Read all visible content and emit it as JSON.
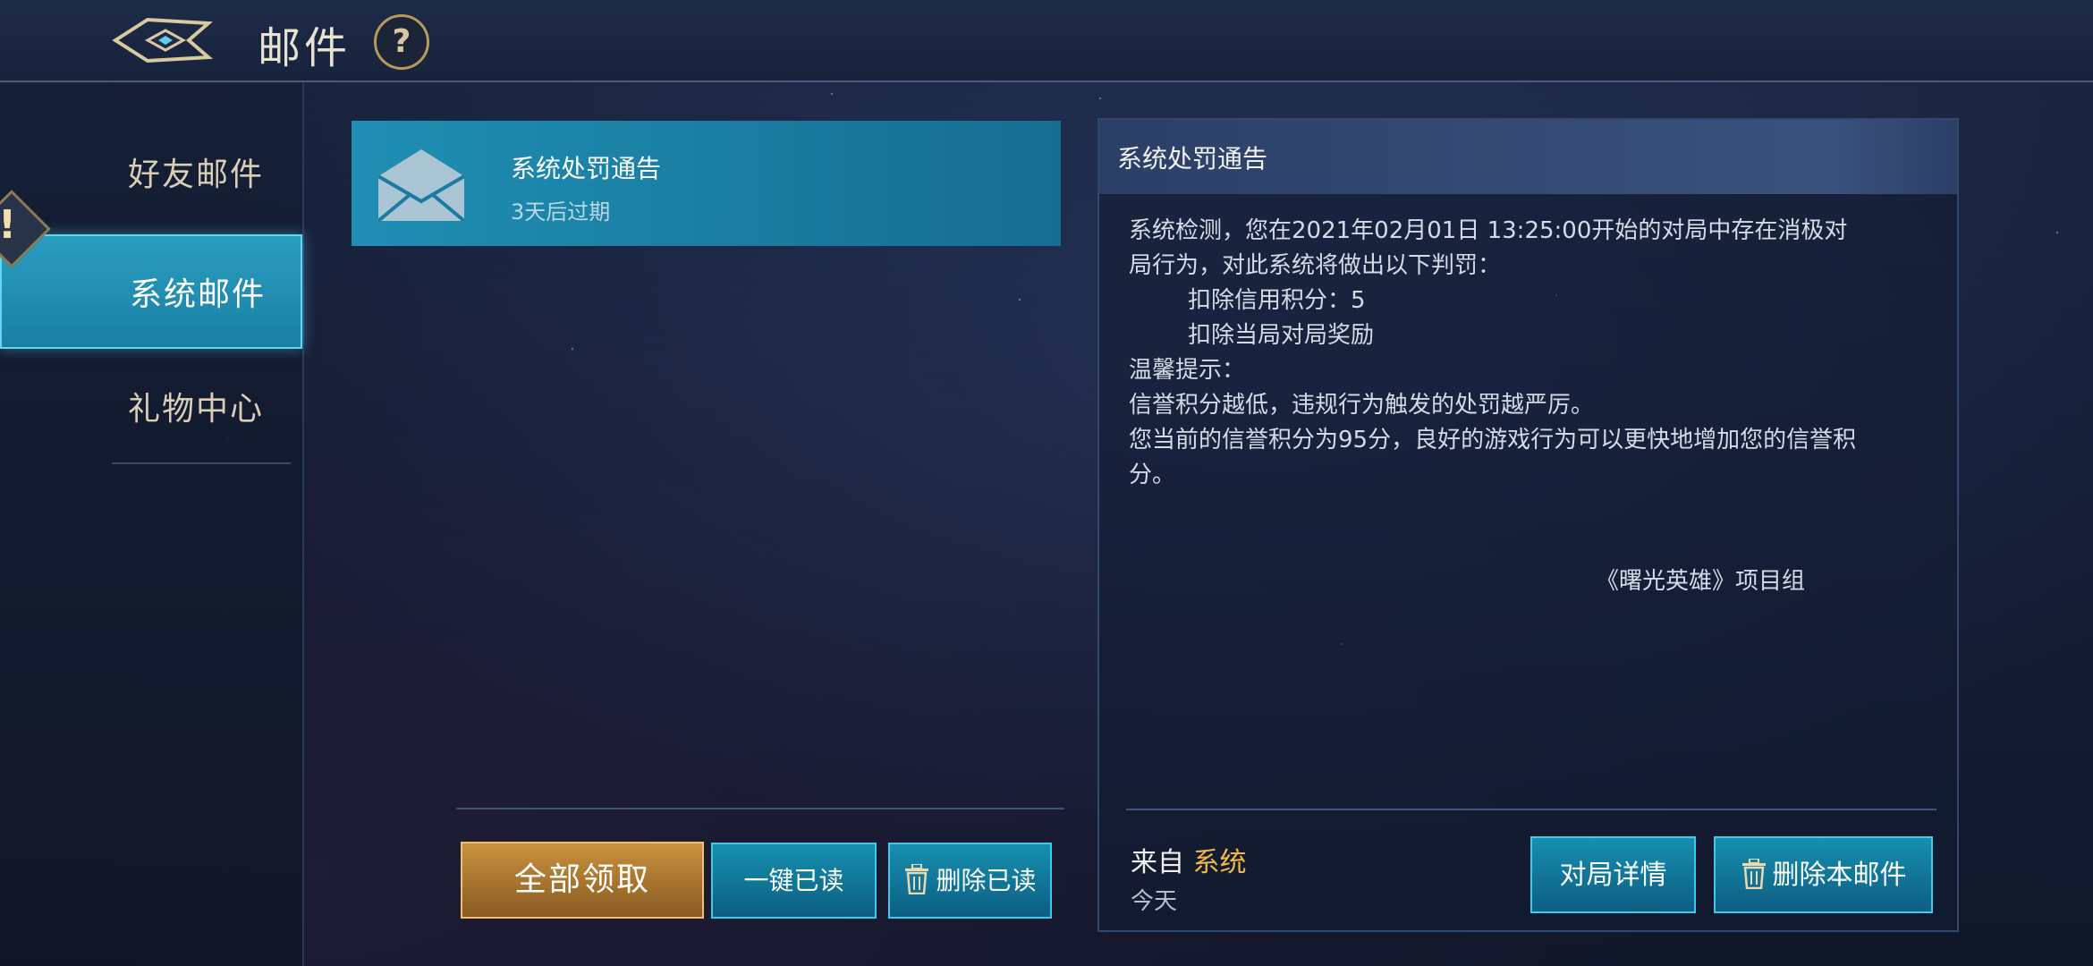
{
  "header": {
    "title": "邮件",
    "help_label": "?"
  },
  "sidebar": {
    "items": [
      {
        "label": "好友邮件"
      },
      {
        "label": "系统邮件"
      },
      {
        "label": "礼物中心"
      }
    ],
    "alert_label": "!"
  },
  "mail_list": [
    {
      "title": "系统处罚通告",
      "expire": "3天后过期"
    }
  ],
  "list_actions": {
    "claim_all": "全部领取",
    "read_all": "一键已读",
    "delete_read": "删除已读"
  },
  "detail": {
    "title": "系统处罚通告",
    "lines": [
      "系统检测，您在2021年02月01日 13:25:00开始的对局中存在消极对",
      "局行为，对此系统将做出以下判罚：",
      "扣除信用积分：5",
      "扣除当局对局奖励",
      "温馨提示：",
      "信誉积分越低，违规行为触发的处罚越严厉。",
      "您当前的信誉积分为95分，良好的游戏行为可以更快地增加您的信誉积",
      "分。"
    ],
    "signature": "《曙光英雄》项目组",
    "from_prefix": "来自 ",
    "from_name": "系统",
    "date": "今天",
    "match_details": "对局详情",
    "delete_mail": "删除本邮件"
  },
  "colors": {
    "accent": "#1f8fb3",
    "gold": "#c9923f",
    "highlight": "#f0b848"
  }
}
